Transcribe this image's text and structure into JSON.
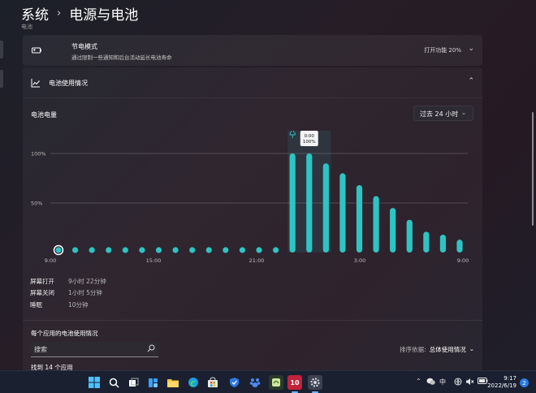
{
  "breadcrumb": {
    "parent": "系统",
    "separator": "›",
    "current": "电源与电池"
  },
  "cut_heading": "电池",
  "battery_saver": {
    "title": "节电模式",
    "subtitle": "通过限制一些通知和后台活动延长电池寿命",
    "status": "打开功能 20%"
  },
  "usage": {
    "title": "电池使用情况",
    "level_label": "电池电量",
    "range_select": "过去 24 小时"
  },
  "chart_data": {
    "type": "bar",
    "title": "电池电量",
    "y_ticks": [
      "100%",
      "50%"
    ],
    "ylim": [
      0,
      100
    ],
    "x_ticks": [
      "9:00",
      "15:00",
      "21:00",
      "3:00",
      "9:00"
    ],
    "tooltip": {
      "time": "0:00",
      "value": "100%"
    },
    "accent": "#2ec4c4",
    "values": [
      0,
      0,
      0,
      0,
      0,
      0,
      0,
      0,
      0,
      0,
      0,
      0,
      0,
      0,
      100,
      100,
      90,
      80,
      68,
      57,
      45,
      33,
      21,
      18,
      13
    ],
    "selected_index": 0,
    "charging_index": 14
  },
  "stats": [
    {
      "label": "屏幕打开",
      "value": "9小时 22分钟"
    },
    {
      "label": "屏幕关闭",
      "value": "1小时 5分钟"
    },
    {
      "label": "睡眠",
      "value": "10分钟"
    }
  ],
  "per_app": {
    "title": "每个应用的电池使用情况",
    "search_placeholder": "搜索",
    "sort_label": "排序依据:",
    "sort_value": "总体使用情况",
    "found": "找到 14 个应用"
  },
  "taskbar": {
    "apps": [
      "windows-start",
      "search",
      "task-view",
      "widgets",
      "file-explorer",
      "edge",
      "store",
      "defender",
      "baidu-netdisk",
      "app-green",
      "app-10",
      "settings"
    ],
    "ime": "中",
    "time": "9:17",
    "date": "2022/6/19",
    "notifications": "2"
  }
}
